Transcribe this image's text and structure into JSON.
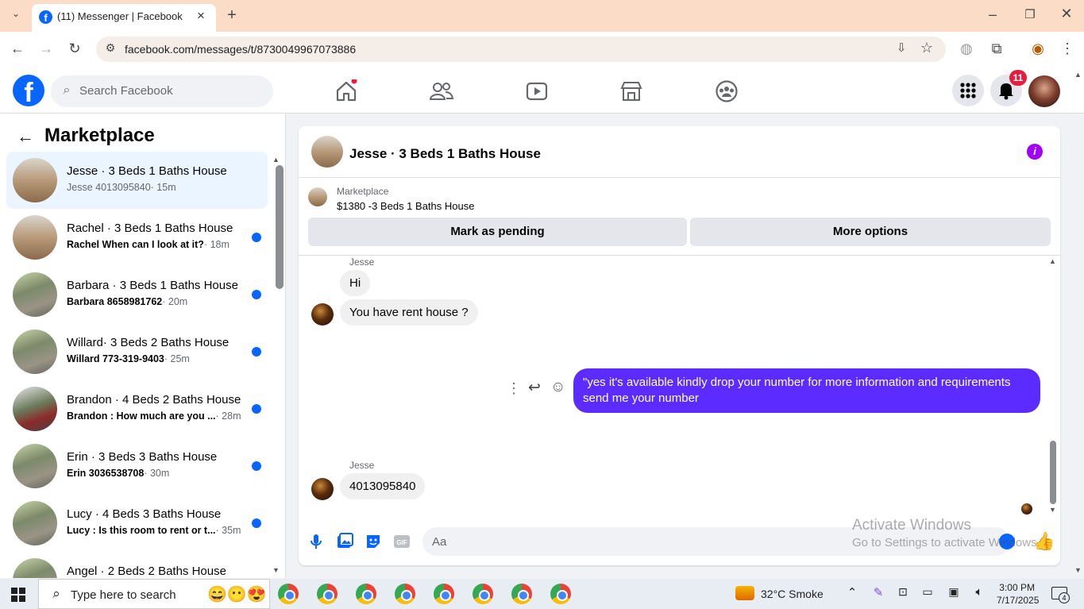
{
  "browser": {
    "tab_title": "(11) Messenger | Facebook",
    "url": "facebook.com/messages/t/8730049967073886"
  },
  "header": {
    "search_placeholder": "Search Facebook",
    "notification_count": "11"
  },
  "left_panel": {
    "title": "Marketplace",
    "conversations": [
      {
        "name": "Jesse · 3 Beds 1 Baths House",
        "preview": "Jesse 4013095840",
        "time": "· 15m",
        "unread": false
      },
      {
        "name": "Rachel · 3 Beds 1 Baths House",
        "preview": "Rachel When can I look at it?",
        "time": "· 18m",
        "unread": true
      },
      {
        "name": "Barbara · 3 Beds 1 Baths House",
        "preview": "Barbara 8658981762",
        "time": "· 20m",
        "unread": true
      },
      {
        "name": "Willard· 3 Beds 2 Baths House",
        "preview": "Willard 773-319-9403",
        "time": "· 25m",
        "unread": true
      },
      {
        "name": "Brandon · 4 Beds 2 Baths House",
        "preview": "Brandon : How much are you ...",
        "time": "· 28m",
        "unread": true
      },
      {
        "name": "Erin · 3 Beds 3 Baths House",
        "preview": "Erin 3036538708",
        "time": "· 30m",
        "unread": true
      },
      {
        "name": "Lucy · 4 Beds 3 Baths House",
        "preview": "Lucy : Is this room to rent or t...",
        "time": "· 35m",
        "unread": true
      },
      {
        "name": "Angel · 2 Beds 2 Baths House",
        "preview": "",
        "time": "",
        "unread": true
      }
    ]
  },
  "chat": {
    "title": "Jesse · 3 Beds 1 Baths House",
    "marketplace_label": "Marketplace",
    "item": "$1380 -3 Beds 1 Baths House",
    "mark_pending": "Mark as pending",
    "more_options": "More options",
    "messages": {
      "sender1": "Jesse",
      "hi": "Hi",
      "rent": "You have rent house ?",
      "outgoing": "\"yes it's available kindly drop your number for more information and requirements send me your number",
      "sender2": "Jesse",
      "number": "4013095840"
    },
    "composer_placeholder": "Aa"
  },
  "watermark": {
    "line1": "Activate Windows",
    "line2": "Go to Settings to activate Windows."
  },
  "taskbar": {
    "search": "Type here to search",
    "weather": "32°C  Smoke",
    "time": "3:00 PM",
    "date": "7/17/2025",
    "notif": "4"
  }
}
